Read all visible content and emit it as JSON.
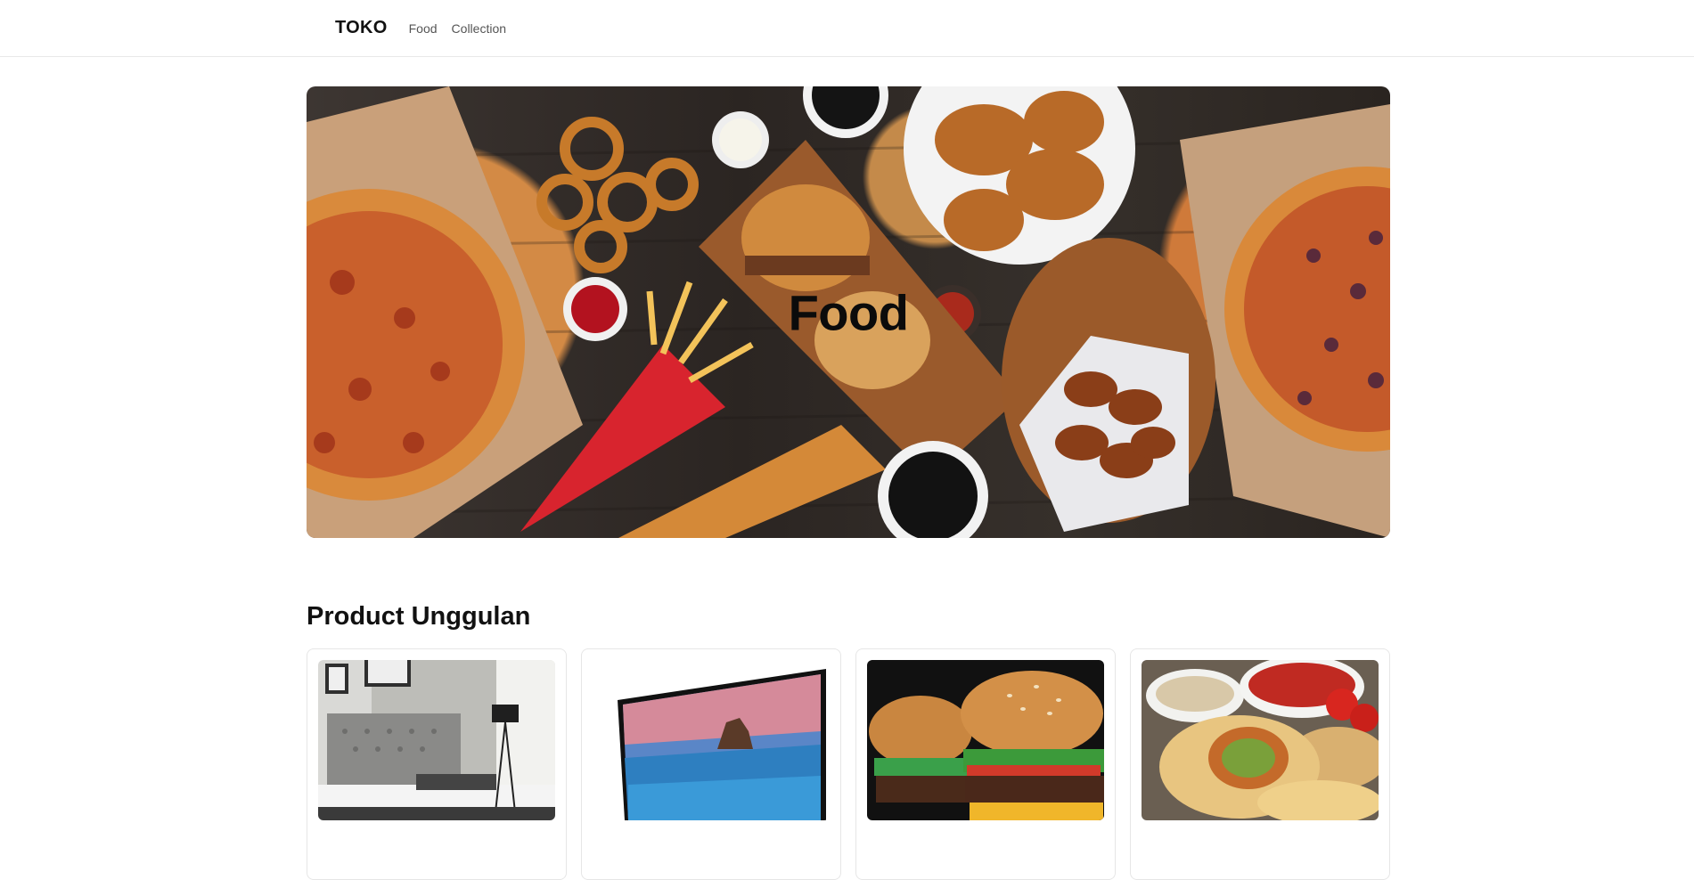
{
  "nav": {
    "brand": "TOKO",
    "links": [
      {
        "label": "Food"
      },
      {
        "label": "Collection"
      }
    ]
  },
  "hero": {
    "title": "Food",
    "image": "food-spread-photo"
  },
  "section": {
    "title": "Product Unggulan"
  },
  "products": [
    {
      "image": "bedroom-photo"
    },
    {
      "image": "tv-photo"
    },
    {
      "image": "burger-photo"
    },
    {
      "image": "wrap-photo"
    }
  ]
}
